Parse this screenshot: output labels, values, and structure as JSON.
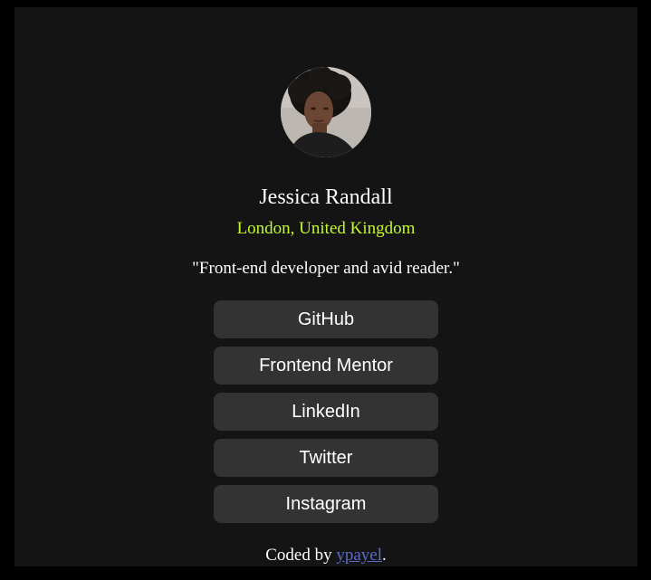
{
  "profile": {
    "name": "Jessica Randall",
    "location": "London, United Kingdom",
    "bio": "\"Front-end developer and avid reader.\""
  },
  "links": [
    {
      "label": "GitHub"
    },
    {
      "label": "Frontend Mentor"
    },
    {
      "label": "LinkedIn"
    },
    {
      "label": "Twitter"
    },
    {
      "label": "Instagram"
    }
  ],
  "footer": {
    "prefix": "Coded by ",
    "author": "ypayel",
    "suffix": "."
  },
  "colors": {
    "page_background": "#000000",
    "card_background": "#141414",
    "button_background": "#333333",
    "accent": "#c4f82a",
    "link": "#5a6ac6"
  }
}
